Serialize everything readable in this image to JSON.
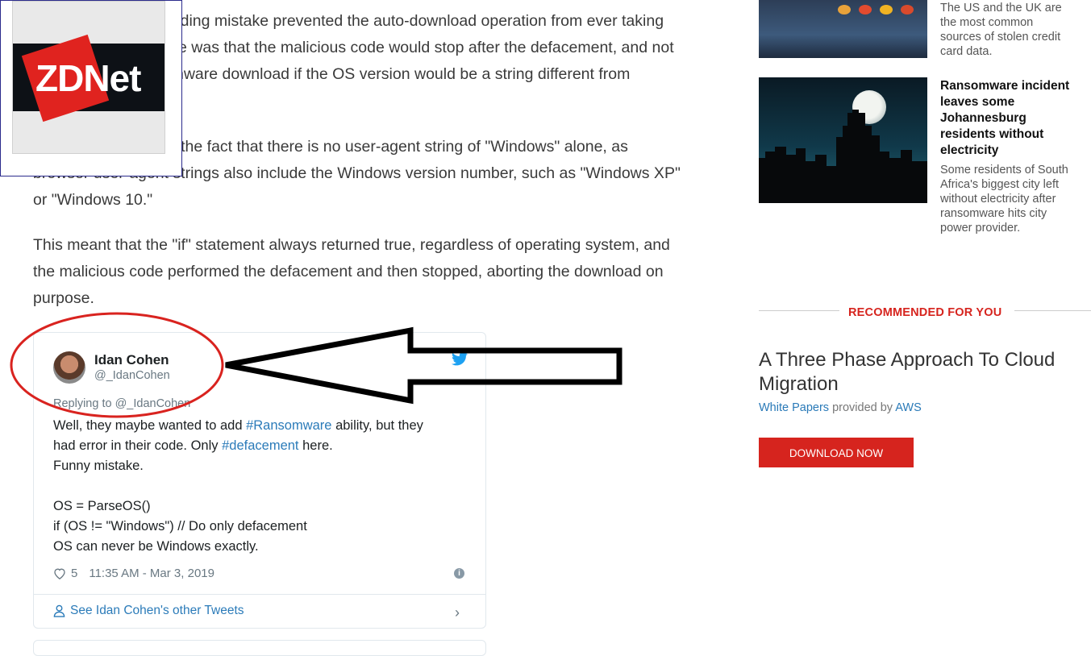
{
  "article": {
    "para1_lines": [
      "coding mistake prevented the auto-download operation from ever taking",
      "e was that the malicious code would stop after the defacement, and not",
      "nware download if the OS version would be a string different from"
    ],
    "para2_lines": [
      "The error came from the fact that there is no user-agent string of \"Windows\" alone, as",
      "browser user-agent strings also include the Windows version number, such as \"Windows XP\"",
      "or \"Windows 10.\""
    ],
    "para3_lines": [
      "This meant that the \"if\" statement always returned true, regardless of operating system, and",
      "the malicious code performed the defacement and then stopped, aborting the download on",
      "purpose."
    ]
  },
  "logo": {
    "text": "ZDNet",
    "accent": "#e0231f"
  },
  "tweet": {
    "name": "Idan Cohen",
    "handle": "@_IdanCohen",
    "replying_to": "Replying to @_IdanCohen",
    "line1_a": "Well, they maybe wanted to add ",
    "line1_hash": "#Ransomware",
    "line1_b": " ability, but they",
    "line2_a": "had error in their code. Only ",
    "line2_hash": "#defacement",
    "line2_b": " here.",
    "line3": "Funny mistake.",
    "line5": "OS = ParseOS()",
    "line6": "if (OS != \"Windows\") // Do only defacement",
    "line7": "OS can never be Windows exactly.",
    "likes": "5",
    "timestamp": "11:35 AM - Mar 3, 2019",
    "see_more": "See Idan Cohen's other Tweets",
    "icons": [
      "twitter-bird-icon",
      "heart-icon",
      "info-icon",
      "person-icon",
      "chevron-right-icon"
    ]
  },
  "sidebar": {
    "story1_text": [
      "The US and the UK are",
      "the most common",
      "sources of stolen credit",
      "card data."
    ],
    "story2_title": [
      "Ransomware incident",
      "leaves some",
      "Johannesburg",
      "residents without",
      "electricity"
    ],
    "story2_text": [
      "Some residents of South",
      "Africa's biggest city left",
      "without electricity after",
      "ransomware hits city",
      "power provider."
    ]
  },
  "recommended": {
    "label": "RECOMMENDED FOR YOU",
    "title": "A Three Phase Approach To Cloud Migration",
    "meta_link1": "White Papers",
    "meta_mid": " provided by ",
    "meta_link2": "AWS",
    "button": "DOWNLOAD NOW",
    "accent": "#d6241e"
  }
}
